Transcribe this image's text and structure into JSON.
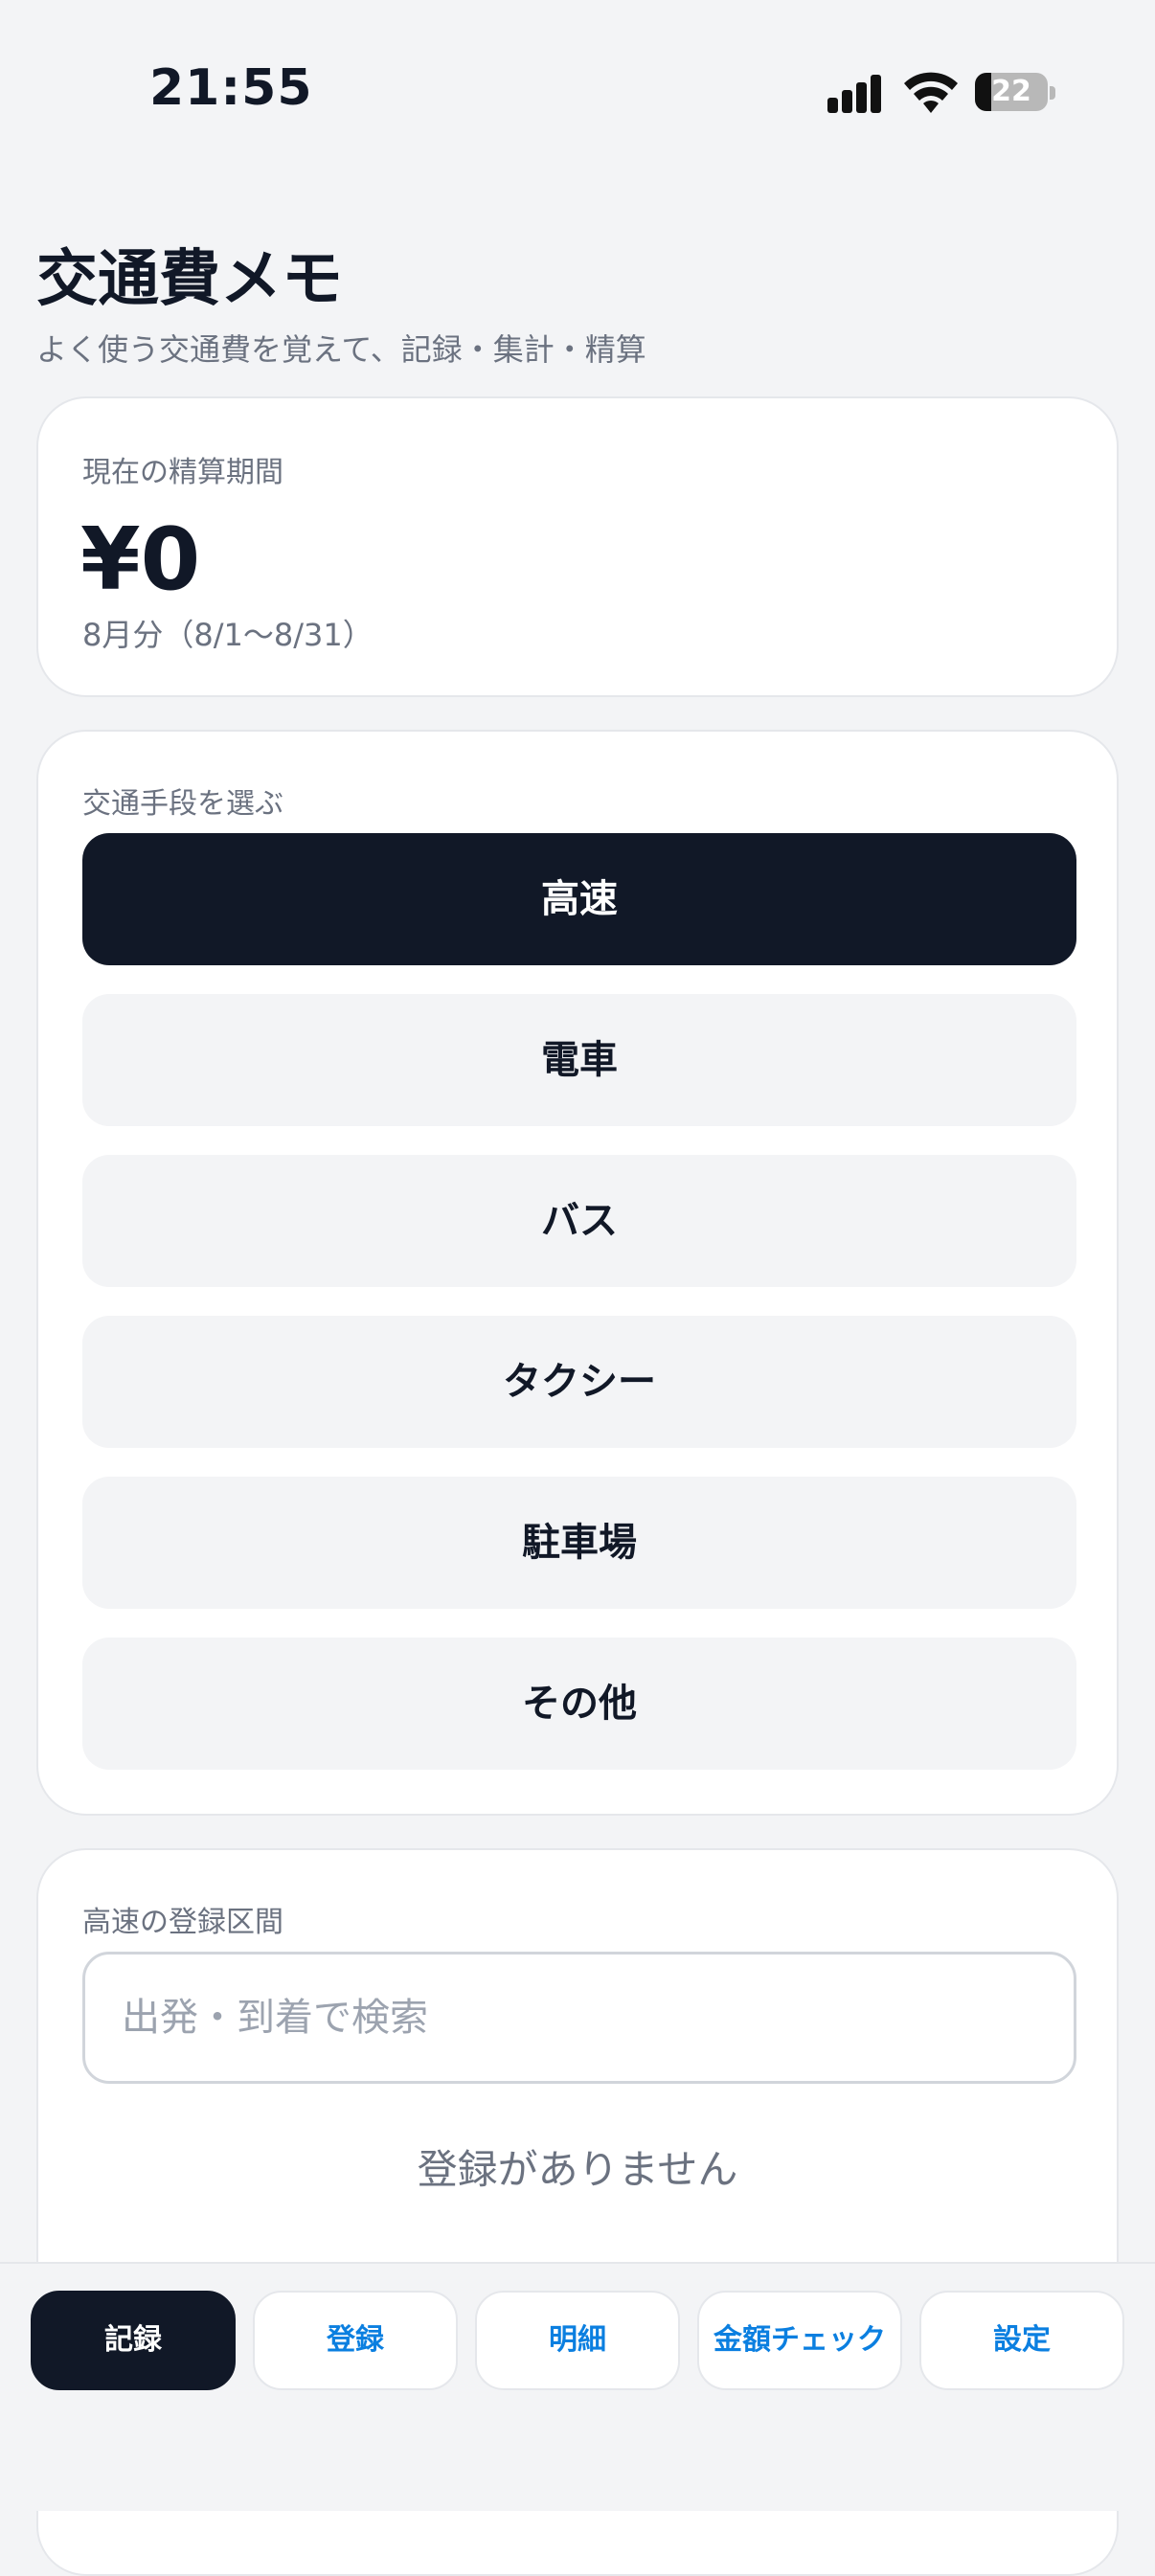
{
  "status_bar": {
    "time": "21:55",
    "battery": "22"
  },
  "app": {
    "title": "交通費メモ",
    "subtitle": "よく使う交通費を覚えて、記録・集計・精算"
  },
  "period": {
    "label": "現在の精算期間",
    "amount": "¥0",
    "range": "8月分（8/1〜8/31）"
  },
  "modes": {
    "label": "交通手段を選ぶ",
    "items": [
      {
        "label": "高速",
        "selected": true
      },
      {
        "label": "電車",
        "selected": false
      },
      {
        "label": "バス",
        "selected": false
      },
      {
        "label": "タクシー",
        "selected": false
      },
      {
        "label": "駐車場",
        "selected": false
      },
      {
        "label": "その他",
        "selected": false
      }
    ]
  },
  "routes": {
    "label": "高速の登録区間",
    "search_placeholder": "出発・到着で検索",
    "search_value": "",
    "empty_message": "登録がありません"
  },
  "tabs": [
    {
      "label": "記録",
      "active": true
    },
    {
      "label": "登録",
      "active": false
    },
    {
      "label": "明細",
      "active": false
    },
    {
      "label": "金額チェック",
      "active": false
    },
    {
      "label": "設定",
      "active": false
    }
  ],
  "colors": {
    "background": "#f3f4f6",
    "primary_dark": "#111827",
    "accent_blue": "#0b7fe0",
    "muted_text": "#6b7280"
  }
}
